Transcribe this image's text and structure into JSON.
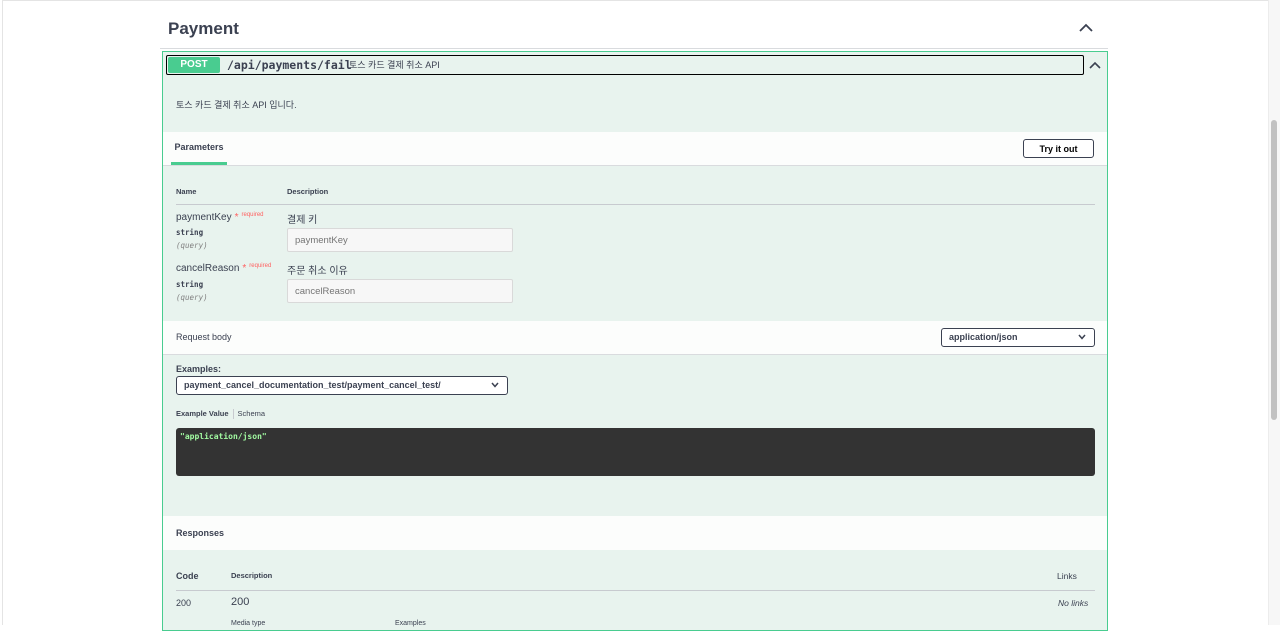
{
  "section": {
    "title": "Payment"
  },
  "operation": {
    "method": "POST",
    "path": "/api/payments/fail",
    "summary": "토스 카드 결제 취소 API",
    "description": "토스 카드 결제 취소 API 입니다.",
    "method_color": "#49cc90"
  },
  "parameters": {
    "tab_label": "Parameters",
    "try_button": "Try it out",
    "col_name": "Name",
    "col_description": "Description",
    "required_label": "required",
    "items": [
      {
        "name": "paymentKey",
        "type": "string",
        "in": "(query)",
        "description": "결제 키",
        "placeholder": "paymentKey"
      },
      {
        "name": "cancelReason",
        "type": "string",
        "in": "(query)",
        "description": "주문 취소 이유",
        "placeholder": "cancelReason"
      }
    ]
  },
  "request_body": {
    "label": "Request body",
    "content_type": "application/json",
    "examples_label": "Examples:",
    "example_selected": "payment_cancel_documentation_test/payment_cancel_test/",
    "tab_example_value": "Example Value",
    "tab_schema": "Schema",
    "example_code": "\"application/json\""
  },
  "responses": {
    "label": "Responses",
    "col_code": "Code",
    "col_description": "Description",
    "col_links": "Links",
    "rows": [
      {
        "code": "200",
        "description": "200",
        "links": "No links",
        "media_type_label": "Media type",
        "examples_label": "Examples"
      }
    ]
  }
}
